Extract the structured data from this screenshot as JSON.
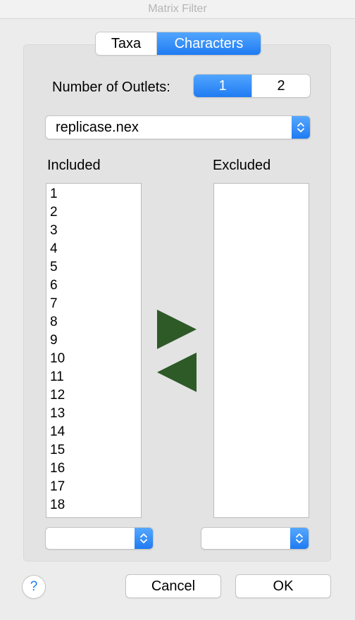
{
  "window": {
    "title": "Matrix Filter"
  },
  "tabs": [
    {
      "label": "Taxa",
      "selected": false
    },
    {
      "label": "Characters",
      "selected": true
    }
  ],
  "outlets": {
    "label": "Number of Outlets:",
    "options": [
      "1",
      "2"
    ],
    "selected": "1"
  },
  "file_popup": {
    "value": "replicase.nex"
  },
  "included": {
    "label": "Included",
    "items": [
      "1",
      "2",
      "3",
      "4",
      "5",
      "6",
      "7",
      "8",
      "9",
      "10",
      "11",
      "12",
      "13",
      "14",
      "15",
      "16",
      "17",
      "18"
    ],
    "popup_value": ""
  },
  "excluded": {
    "label": "Excluded",
    "items": [],
    "popup_value": ""
  },
  "move_buttons": {
    "exclude_icon": "triangle-right",
    "include_icon": "triangle-left",
    "color": "#2d5a27"
  },
  "help": {
    "label": "?"
  },
  "buttons": {
    "cancel": "Cancel",
    "ok": "OK"
  },
  "colors": {
    "accent": "#1f7bf2",
    "arrow": "#2d5a27"
  }
}
